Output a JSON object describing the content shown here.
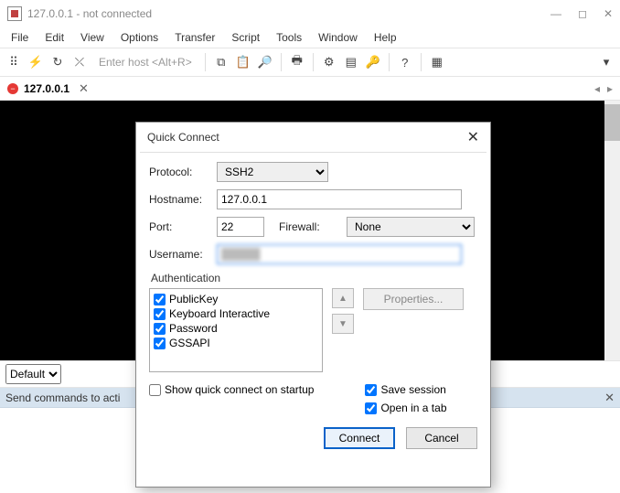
{
  "window": {
    "title": "127.0.0.1 - not connected"
  },
  "menu": {
    "file": "File",
    "edit": "Edit",
    "view": "View",
    "options": "Options",
    "transfer": "Transfer",
    "script": "Script",
    "tools": "Tools",
    "window": "Window",
    "help": "Help"
  },
  "toolbar": {
    "host_placeholder": "Enter host <Alt+R>"
  },
  "tab": {
    "label": "127.0.0.1"
  },
  "scheme": {
    "value": "Default"
  },
  "status": {
    "text": "Send commands to acti"
  },
  "dialog": {
    "title": "Quick Connect",
    "labels": {
      "protocol": "Protocol:",
      "hostname": "Hostname:",
      "port": "Port:",
      "firewall": "Firewall:",
      "username": "Username:",
      "authentication": "Authentication"
    },
    "values": {
      "protocol": "SSH2",
      "hostname": "127.0.0.1",
      "port": "22",
      "firewall": "None",
      "username": "█████"
    },
    "auth_methods": {
      "publickey": "PublicKey",
      "keyboard": "Keyboard Interactive",
      "password": "Password",
      "gssapi": "GSSAPI"
    },
    "properties_btn": "Properties...",
    "options": {
      "show_on_startup": "Show quick connect on startup",
      "save_session": "Save session",
      "open_in_tab": "Open in a tab"
    },
    "buttons": {
      "connect": "Connect",
      "cancel": "Cancel"
    }
  }
}
